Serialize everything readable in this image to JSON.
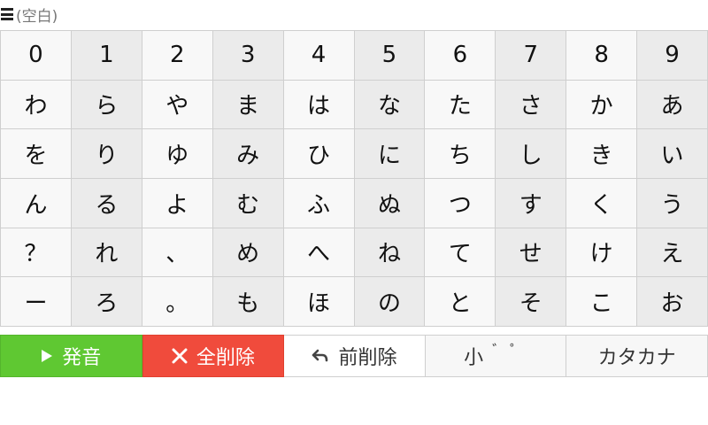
{
  "header": {
    "display_text": "(空白)"
  },
  "keyboard": {
    "rows": [
      [
        "0",
        "1",
        "2",
        "3",
        "4",
        "5",
        "6",
        "7",
        "8",
        "9"
      ],
      [
        "わ",
        "ら",
        "や",
        "ま",
        "は",
        "な",
        "た",
        "さ",
        "か",
        "あ"
      ],
      [
        "を",
        "り",
        "ゆ",
        "み",
        "ひ",
        "に",
        "ち",
        "し",
        "き",
        "い"
      ],
      [
        "ん",
        "る",
        "よ",
        "む",
        "ふ",
        "ぬ",
        "つ",
        "す",
        "く",
        "う"
      ],
      [
        "？",
        "れ",
        "、",
        "め",
        "へ",
        "ね",
        "て",
        "せ",
        "け",
        "え"
      ],
      [
        "ー",
        "ろ",
        "。",
        "も",
        "ほ",
        "の",
        "と",
        "そ",
        "こ",
        "お"
      ]
    ]
  },
  "actions": {
    "speak_label": "発音",
    "clear_label": "全削除",
    "backspace_label": "前削除",
    "small_label": "小",
    "marks_label": "゛゜",
    "katakana_label": "カタカナ"
  },
  "colors": {
    "speak": "#5fc832",
    "clear": "#f04b3c",
    "key_bg": "#f8f8f8",
    "key_shade": "#ebebeb"
  }
}
